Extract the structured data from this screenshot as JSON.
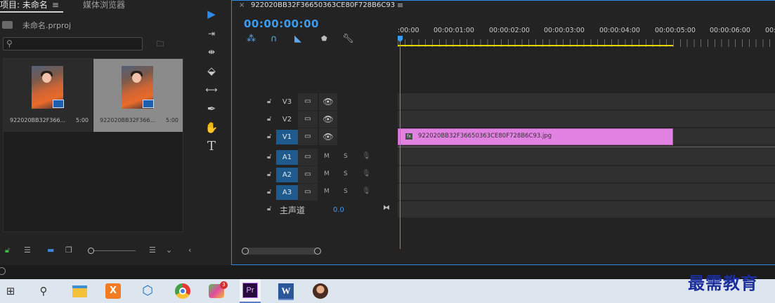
{
  "project_panel": {
    "tab_project": "项目: 未命名",
    "tab_menu": "≡",
    "tab_media_browser": "媒体浏览器",
    "project_file": "未命名.prproj",
    "search_icon": "search-icon",
    "new_bin_icon": "new-bin-icon",
    "clips": [
      {
        "name": "922020BB32F366...",
        "duration": "5:00",
        "selected": false
      },
      {
        "name": "922020BB32F366...",
        "duration": "5:00",
        "selected": true
      }
    ],
    "footer": {
      "icons": [
        "lock-icon",
        "list-view-icon",
        "icon-view-icon",
        "freeform-view-icon",
        "zoom-slider",
        "sort-icon",
        "more-icon"
      ]
    }
  },
  "tools": [
    "selection-tool",
    "track-select-tool",
    "ripple-edit-tool",
    "razor-tool",
    "slip-tool",
    "pen-tool",
    "hand-tool",
    "type-tool"
  ],
  "timeline": {
    "close": "×",
    "sequence_name": "922020BB32F36650363CE80F728B6C93",
    "menu": "≡",
    "timecode": "00:00:00:00",
    "ruler_labels": [
      ":00:00",
      "00:00:01:00",
      "00:00:02:00",
      "00:00:03:00",
      "00:00:04:00",
      "00:00:05:00",
      "00:00:06:00",
      "00:00"
    ],
    "video_tracks": [
      {
        "name": "V3",
        "targeted": false
      },
      {
        "name": "V2",
        "targeted": false
      },
      {
        "name": "V1",
        "targeted": true
      }
    ],
    "audio_tracks": [
      {
        "name": "A1",
        "mute": "M",
        "solo": "S"
      },
      {
        "name": "A2",
        "mute": "M",
        "solo": "S"
      },
      {
        "name": "A3",
        "mute": "M",
        "solo": "S"
      }
    ],
    "master_label": "主声道",
    "master_volume": "0.0",
    "clip_label": "922020BB32F36650363CE80F728B6C93.jpg",
    "clip_color": "#e181e1",
    "accent_color": "#2d8ceb"
  },
  "taskbar": {
    "apps": [
      "windows-start",
      "search",
      "file-explorer",
      "xampp",
      "3d-viewer",
      "chrome",
      "game",
      "premiere-pro",
      "word",
      "photo"
    ],
    "premiere_label": "Pr",
    "word_label": "W",
    "xampp_label": "X",
    "game_badge": "3"
  },
  "watermark": "最需教育"
}
